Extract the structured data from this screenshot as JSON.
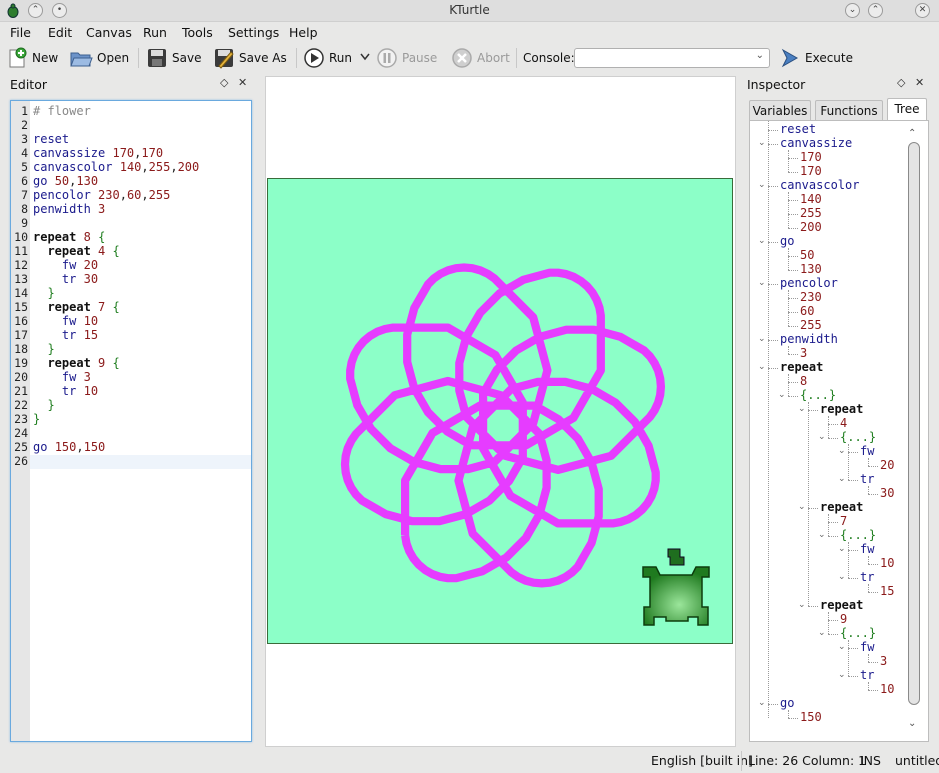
{
  "window": {
    "title": "KTurtle"
  },
  "menubar": [
    "File",
    "Edit",
    "Canvas",
    "Run",
    "Tools",
    "Settings",
    "Help"
  ],
  "toolbar": {
    "new": "New",
    "open": "Open",
    "save": "Save",
    "save_as": "Save As",
    "run": "Run",
    "pause": "Pause",
    "abort": "Abort",
    "console_label": "Console:",
    "console_value": "",
    "execute": "Execute"
  },
  "editor": {
    "title": "Editor",
    "lines": [
      "# flower",
      "",
      "reset",
      "canvassize 170,170",
      "canvascolor 140,255,200",
      "go 50,130",
      "pencolor 230,60,255",
      "penwidth 3",
      "",
      "repeat 8 {",
      "  repeat 4 {",
      "    fw 20",
      "    tr 30",
      "  }",
      "  repeat 7 {",
      "    fw 10",
      "    tr 15",
      "  }",
      "  repeat 9 {",
      "    fw 3",
      "    tr 10",
      "  }",
      "}",
      "",
      "go 150,150",
      ""
    ],
    "line_numbers": [
      "1",
      "2",
      "3",
      "4",
      "5",
      "6",
      "7",
      "8",
      "9",
      "10",
      "11",
      "12",
      "13",
      "14",
      "15",
      "16",
      "17",
      "18",
      "19",
      "20",
      "21",
      "22",
      "23",
      "24",
      "25",
      "26"
    ]
  },
  "canvas": {
    "background": "#8cffc8",
    "pen_color": "#e63cff",
    "pen_width": 3,
    "turtle_color": "#2e8b2e"
  },
  "inspector": {
    "title": "Inspector",
    "tabs": [
      "Variables",
      "Functions",
      "Tree"
    ],
    "active_tab": "Tree",
    "tree": [
      {
        "t": "reset",
        "k": "cmd",
        "d": 0
      },
      {
        "t": "canvassize",
        "k": "cmd",
        "d": 0
      },
      {
        "t": "170",
        "k": "num",
        "d": 1
      },
      {
        "t": "170",
        "k": "num",
        "d": 1
      },
      {
        "t": "canvascolor",
        "k": "cmd",
        "d": 0
      },
      {
        "t": "140",
        "k": "num",
        "d": 1
      },
      {
        "t": "255",
        "k": "num",
        "d": 1
      },
      {
        "t": "200",
        "k": "num",
        "d": 1
      },
      {
        "t": "go",
        "k": "cmd",
        "d": 0
      },
      {
        "t": "50",
        "k": "num",
        "d": 1
      },
      {
        "t": "130",
        "k": "num",
        "d": 1
      },
      {
        "t": "pencolor",
        "k": "cmd",
        "d": 0
      },
      {
        "t": "230",
        "k": "num",
        "d": 1
      },
      {
        "t": "60",
        "k": "num",
        "d": 1
      },
      {
        "t": "255",
        "k": "num",
        "d": 1
      },
      {
        "t": "penwidth",
        "k": "cmd",
        "d": 0
      },
      {
        "t": "3",
        "k": "num",
        "d": 1
      },
      {
        "t": "repeat",
        "k": "kw",
        "d": 0
      },
      {
        "t": "8",
        "k": "num",
        "d": 1
      },
      {
        "t": "{...}",
        "k": "brace",
        "d": 1
      },
      {
        "t": "repeat",
        "k": "kw",
        "d": 2
      },
      {
        "t": "4",
        "k": "num",
        "d": 3
      },
      {
        "t": "{...}",
        "k": "brace",
        "d": 3
      },
      {
        "t": "fw",
        "k": "cmd",
        "d": 4
      },
      {
        "t": "20",
        "k": "num",
        "d": 5
      },
      {
        "t": "tr",
        "k": "cmd",
        "d": 4
      },
      {
        "t": "30",
        "k": "num",
        "d": 5
      },
      {
        "t": "repeat",
        "k": "kw",
        "d": 2
      },
      {
        "t": "7",
        "k": "num",
        "d": 3
      },
      {
        "t": "{...}",
        "k": "brace",
        "d": 3
      },
      {
        "t": "fw",
        "k": "cmd",
        "d": 4
      },
      {
        "t": "10",
        "k": "num",
        "d": 5
      },
      {
        "t": "tr",
        "k": "cmd",
        "d": 4
      },
      {
        "t": "15",
        "k": "num",
        "d": 5
      },
      {
        "t": "repeat",
        "k": "kw",
        "d": 2
      },
      {
        "t": "9",
        "k": "num",
        "d": 3
      },
      {
        "t": "{...}",
        "k": "brace",
        "d": 3
      },
      {
        "t": "fw",
        "k": "cmd",
        "d": 4
      },
      {
        "t": "3",
        "k": "num",
        "d": 5
      },
      {
        "t": "tr",
        "k": "cmd",
        "d": 4
      },
      {
        "t": "10",
        "k": "num",
        "d": 5
      },
      {
        "t": "go",
        "k": "cmd",
        "d": 0
      },
      {
        "t": "150",
        "k": "num",
        "d": 1
      }
    ]
  },
  "statusbar": {
    "language": "English [built in]",
    "position": "Line: 26 Column: 1",
    "mode": "INS",
    "file": "untitled"
  }
}
